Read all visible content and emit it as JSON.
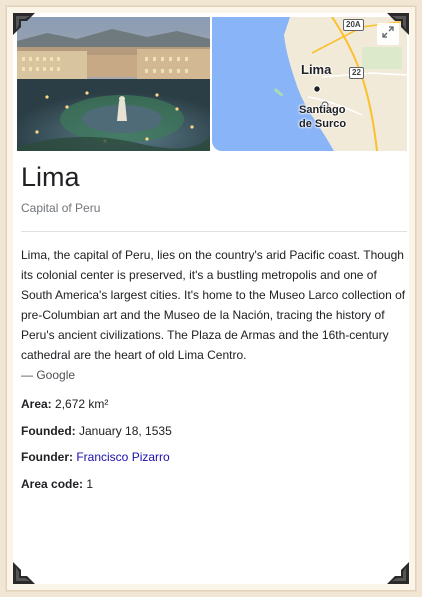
{
  "header": {
    "map_labels": {
      "city": "Lima",
      "district_line1": "Santiago",
      "district_line2": "de Surco",
      "road_1": "20A",
      "road_2": "22"
    }
  },
  "main": {
    "title": "Lima",
    "subtitle": "Capital of Peru",
    "description": "Lima, the capital of Peru, lies on the country's arid Pacific coast. Though its colonial center is preserved, it's a bustling metropolis and one of South America's largest cities. It's home to the Museo Larco collection of pre-Columbian art and the Museo de la Nación, tracing the history of Peru's ancient civilizations. The Plaza de Armas and the 16th-century cathedral are the heart of old Lima Centro.",
    "source": "— Google"
  },
  "facts": [
    {
      "label": "Area:",
      "value": "2,672 km²"
    },
    {
      "label": "Founded:",
      "value": "January 18, 1535"
    },
    {
      "label": "Founder:",
      "value": "Francisco Pizarro"
    },
    {
      "label": "Area code:",
      "value": "1"
    }
  ],
  "icons": [
    "expand-icon",
    "map-pin-icon",
    "frame-corner-icon"
  ],
  "colors": {
    "link": "#1a0dab",
    "title": "#202124",
    "subtitle": "#70757a",
    "map_water": "#8ab4f8",
    "map_land": "#f1ead8"
  }
}
